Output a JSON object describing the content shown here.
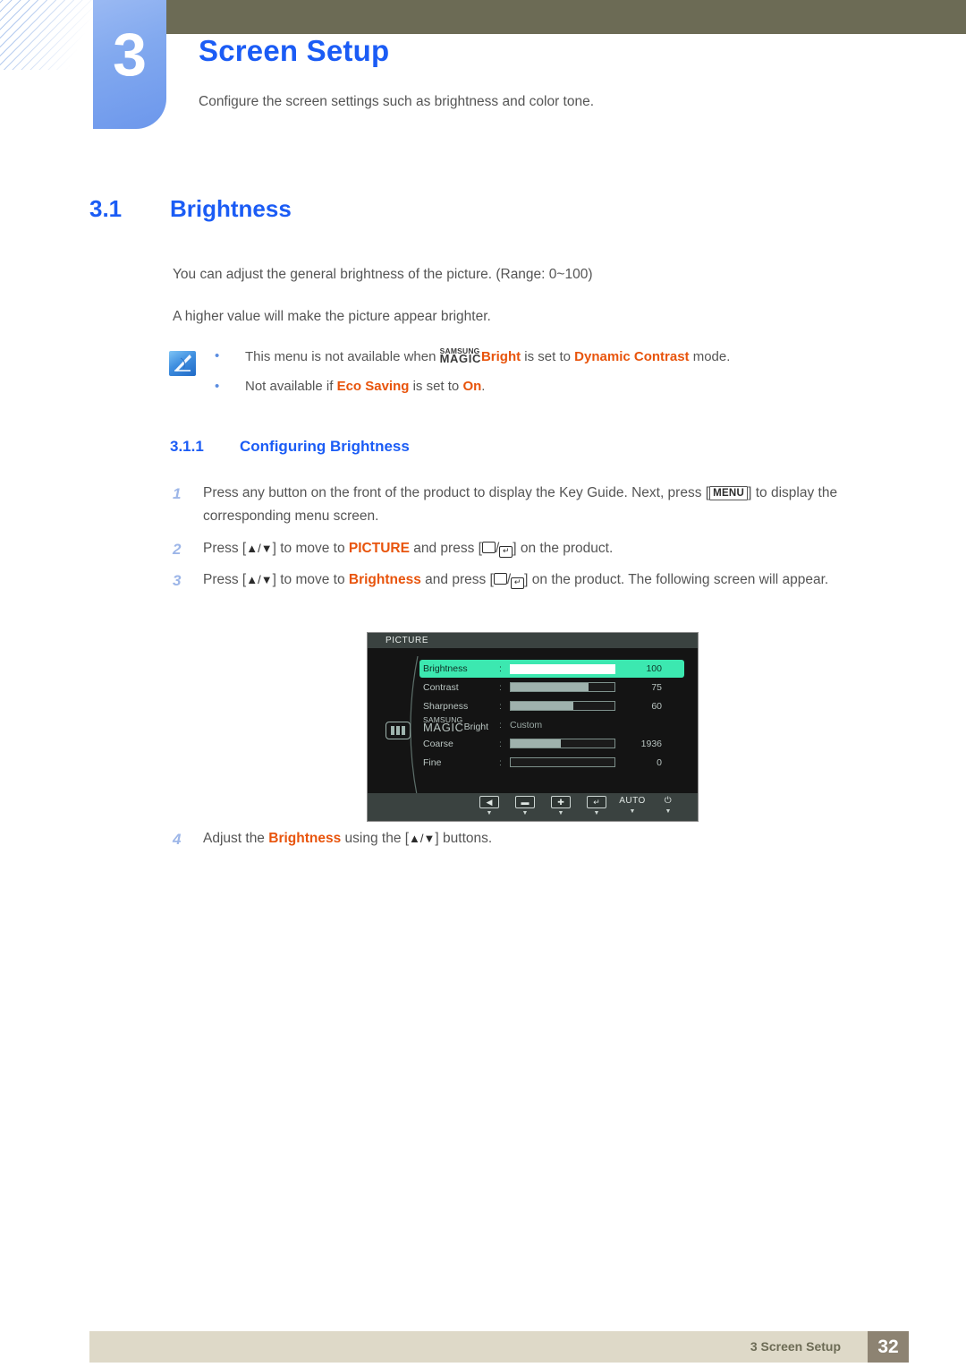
{
  "header": {
    "chapter_number": "3",
    "chapter_title": "Screen Setup",
    "chapter_desc": "Configure the screen settings such as brightness and color tone."
  },
  "section": {
    "number": "3.1",
    "title": "Brightness"
  },
  "body": {
    "paragraph_1": "You can adjust the general brightness of the picture. (Range: 0~100)",
    "paragraph_2": "A higher value will make the picture appear brighter."
  },
  "note": {
    "icon": "note-pen-icon",
    "bullet": "•",
    "items": [
      {
        "pre": "This menu is not available when ",
        "magic_top": "SAMSUNG",
        "magic_bottom": "MAGIC",
        "bright": "Bright",
        "mid": " is set to ",
        "highlight": "Dynamic Contrast",
        "post": " mode."
      },
      {
        "pre": "Not available if ",
        "highlight1": "Eco Saving",
        "mid": " is set to ",
        "highlight2": "On",
        "post": "."
      }
    ]
  },
  "subsection": {
    "number": "3.1.1",
    "title": "Configuring Brightness"
  },
  "steps": [
    {
      "num": "1",
      "part_a": "Press any button on the front of the product to display the Key Guide. Next, press [",
      "key": "MENU",
      "part_b": "] to display the corresponding menu screen."
    },
    {
      "num": "2",
      "part_a": "Press [",
      "arrows": "▲/▼",
      "part_b": "] to move to ",
      "target": "PICTURE",
      "part_c": " and press [",
      "part_d": "] on the product."
    },
    {
      "num": "3",
      "part_a": "Press [",
      "arrows": "▲/▼",
      "part_b": "] to move to ",
      "target": "Brightness",
      "part_c": " and press [",
      "part_d": "] on the product. The following screen will appear."
    },
    {
      "num": "4",
      "part_a": "Adjust the ",
      "target": "Brightness",
      "part_b": " using the [",
      "arrows": "▲/▼",
      "part_c": "] buttons."
    }
  ],
  "osd": {
    "title": "PICTURE",
    "menu_icon": "picture-bars-icon",
    "rows": [
      {
        "label": "Brightness",
        "value": "100",
        "percent": 100,
        "type": "bar",
        "selected": true
      },
      {
        "label": "Contrast",
        "value": "75",
        "percent": 75,
        "type": "bar",
        "selected": false
      },
      {
        "label": "Sharpness",
        "value": "60",
        "percent": 60,
        "type": "bar",
        "selected": false
      },
      {
        "label": "MAGIC Bright",
        "label_top": "SAMSUNG",
        "label_main": "MAGIC",
        "label_suffix": "Bright",
        "value": "Custom",
        "type": "text",
        "selected": false
      },
      {
        "label": "Coarse",
        "value": "1936",
        "percent": 48,
        "type": "bar",
        "selected": false
      },
      {
        "label": "Fine",
        "value": "0",
        "percent": 0,
        "type": "bar",
        "selected": false
      }
    ],
    "buttons": [
      {
        "name": "back-button",
        "glyph": "◀",
        "caret": "▼"
      },
      {
        "name": "minus-button",
        "glyph": "▬",
        "caret": "▼"
      },
      {
        "name": "plus-button",
        "glyph": "✚",
        "caret": "▼"
      },
      {
        "name": "enter-button",
        "glyph": "↵",
        "caret": "▼"
      },
      {
        "name": "auto-button",
        "glyph": "AUTO",
        "caret": "▼"
      },
      {
        "name": "power-button",
        "glyph": "⏻",
        "caret": "▼"
      }
    ]
  },
  "footer": {
    "text": "3 Screen Setup",
    "page": "32"
  },
  "colors": {
    "accent_blue": "#1b5cf5",
    "chapter_block": "#7fa5ee",
    "olive": "#6c6b55",
    "orange": "#e8540c",
    "osd_green": "#3ce8b0",
    "footer_bar": "#ded9c8",
    "footer_page": "#8d8372"
  }
}
